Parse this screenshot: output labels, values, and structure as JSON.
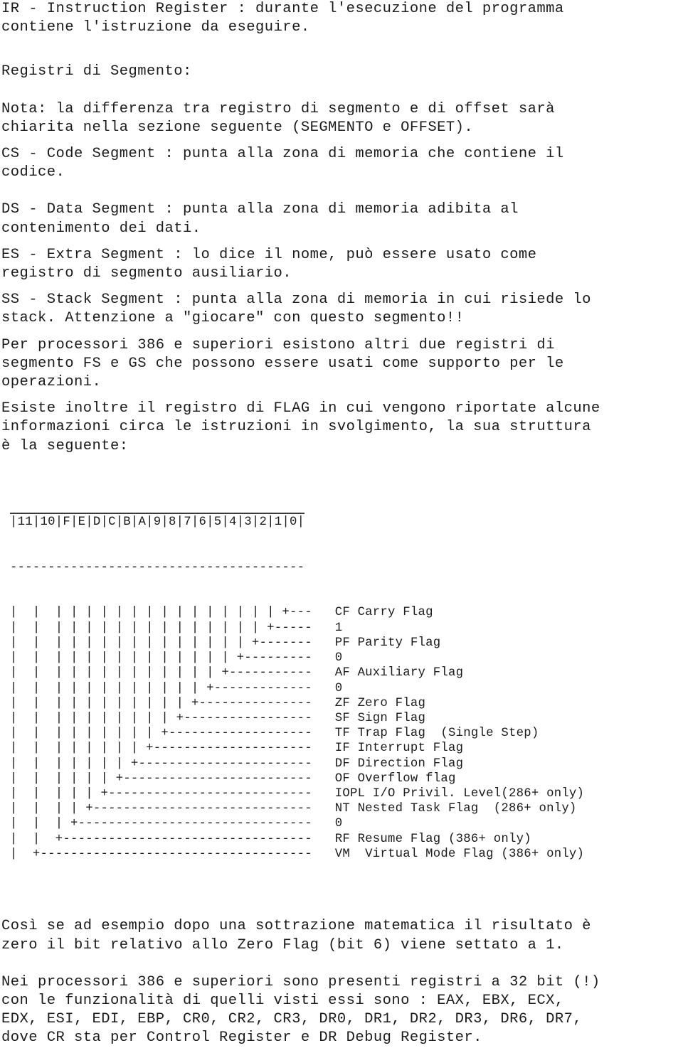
{
  "document": {
    "language": "it",
    "topic": "Registri della CPU x86"
  },
  "paragraphs": [
    {
      "id": "ir-register",
      "text": "IR - Instruction Register : durante l'esecuzione del programma\ncontiene l'istruzione da eseguire."
    },
    {
      "id": "segment-heading",
      "text": "Registri di Segmento:"
    },
    {
      "id": "nota-segment-offset",
      "text": "Nota: la differenza tra registro di segmento e di offset sarà\nchiarita nella sezione seguente (SEGMENTO e OFFSET)."
    },
    {
      "id": "cs-code-segment",
      "text": "CS - Code Segment : punta alla zona di memoria che contiene il\ncodice."
    },
    {
      "id": "ds-data-segment",
      "text": "DS - Data Segment : punta alla zona di memoria adibita al\ncontenimento dei dati."
    },
    {
      "id": "es-extra-segment",
      "text": "ES - Extra Segment : lo dice il nome, può essere usato come\nregistro di segmento ausiliario."
    },
    {
      "id": "ss-stack-segment",
      "text": "SS - Stack Segment : punta alla zona di memoria in cui risiede lo\nstack. Attenzione a \"giocare\" con questo segmento!!"
    },
    {
      "id": "fs-gs-386",
      "text": "Per processori 386 e superiori esistono altri due registri di\nsegmento FS e GS che possono essere usati come supporto per le\noperazioni."
    },
    {
      "id": "flag-register-intro",
      "text": "Esiste inoltre il registro di FLAG in cui vengono riportate alcune\ninformazioni circa le istruzioni in svolgimento, la sua struttura\nè la seguente:"
    }
  ],
  "flags_diagram": {
    "bit_header": "|11|10|F|E|D|C|B|A|9|8|7|6|5|4|3|2|1|0|",
    "separator": "---------------------------------------",
    "rows": [
      {
        "rail": "|  |  | | | | | | | | | | | | | | | +---",
        "label": "CF Carry Flag"
      },
      {
        "rail": "|  |  | | | | | | | | | | | | | | +-----",
        "label": "1"
      },
      {
        "rail": "|  |  | | | | | | | | | | | | | +-------",
        "label": "PF Parity Flag"
      },
      {
        "rail": "|  |  | | | | | | | | | | | | +---------",
        "label": "0"
      },
      {
        "rail": "|  |  | | | | | | | | | | | +-----------",
        "label": "AF Auxiliary Flag"
      },
      {
        "rail": "|  |  | | | | | | | | | | +-------------",
        "label": "0"
      },
      {
        "rail": "|  |  | | | | | | | | | +---------------",
        "label": "ZF Zero Flag"
      },
      {
        "rail": "|  |  | | | | | | | | +-----------------",
        "label": "SF Sign Flag"
      },
      {
        "rail": "|  |  | | | | | | | +-------------------",
        "label": "TF Trap Flag  (Single Step)"
      },
      {
        "rail": "|  |  | | | | | | +---------------------",
        "label": "IF Interrupt Flag"
      },
      {
        "rail": "|  |  | | | | | +-----------------------",
        "label": "DF Direction Flag"
      },
      {
        "rail": "|  |  | | | | +-------------------------",
        "label": "OF Overflow flag"
      },
      {
        "rail": "|  |  | | | +---------------------------",
        "label": "IOPL I/O Privil. Level(286+ only)"
      },
      {
        "rail": "|  |  | | +-----------------------------",
        "label": "NT Nested Task Flag  (286+ only)"
      },
      {
        "rail": "|  |  | +-------------------------------",
        "label": "0"
      },
      {
        "rail": "|  |  +---------------------------------",
        "label": "RF Resume Flag (386+ only)"
      },
      {
        "rail": "|  +------------------------------------",
        "label": "VM  Virtual Mode Flag (386+ only)"
      }
    ]
  },
  "paragraphs_after": [
    {
      "id": "zero-flag-example",
      "text": "Così se ad esempio dopo una sottrazione matematica il risultato è\nzero il bit relativo allo Zero Flag (bit 6) viene settato a 1."
    },
    {
      "id": "registri-32-bit",
      "text": "Nei processori 386 e superiori sono presenti registri a 32 bit (!)\ncon le funzionalità di quelli visti essi sono : EAX, EBX, ECX,\nEDX, ESI, EDI, EBP, CR0, CR2, CR3, DR0, DR1, DR2, DR3, DR6, DR7,\ndove CR sta per Control Register e DR Debug Register."
    }
  ]
}
